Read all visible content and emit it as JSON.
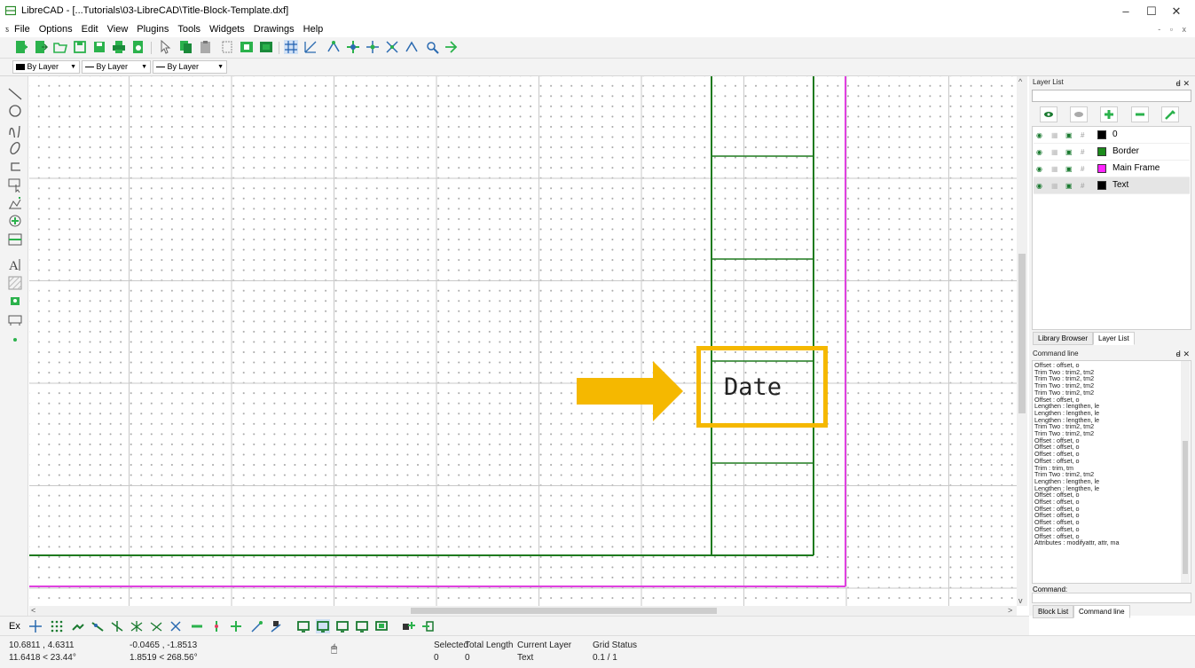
{
  "window": {
    "title": "LibreCAD - [...Tutorials\\03-LibreCAD\\Title-Block-Template.dxf]",
    "controls": [
      "–",
      "☐",
      "✕"
    ]
  },
  "menubar": {
    "items": [
      "File",
      "Options",
      "Edit",
      "View",
      "Plugins",
      "Tools",
      "Widgets",
      "Drawings",
      "Help"
    ],
    "mdi_controls": "- ▫ x"
  },
  "pen_toolbar": {
    "color": "By Layer",
    "width": "By Layer",
    "linetype": "By Layer"
  },
  "drawing": {
    "text_label": "Date",
    "colors": {
      "border": "#1e7a1e",
      "main_frame": "#e040e0",
      "grid": "#c9c9c9",
      "highlight": "#f5b800"
    }
  },
  "layer_panel": {
    "title": "Layer List",
    "layers": [
      {
        "name": "0",
        "color": "#000000",
        "selected": false
      },
      {
        "name": "Border",
        "color": "#1b8a1b",
        "selected": false
      },
      {
        "name": "Main Frame",
        "color": "#ff22ff",
        "selected": false
      },
      {
        "name": "Text",
        "color": "#000000",
        "selected": true
      }
    ],
    "tabs": [
      "Library Browser",
      "Layer List"
    ]
  },
  "command_panel": {
    "title": "Command line",
    "history": [
      "Offset : offset, o",
      "Trim Two : trim2, tm2",
      "Trim Two : trim2, tm2",
      "Trim Two : trim2, tm2",
      "Trim Two : trim2, tm2",
      "Offset : offset, o",
      "Lengthen : lengthen, le",
      "Lengthen : lengthen, le",
      "Lengthen : lengthen, le",
      "Trim Two : trim2, tm2",
      "Trim Two : trim2, tm2",
      "Offset : offset, o",
      "Offset : offset, o",
      "Offset : offset, o",
      "Offset : offset, o",
      "Trim : trim, tm",
      "Trim Two : trim2, tm2",
      "Lengthen : lengthen, le",
      "Lengthen : lengthen, le",
      "Offset : offset, o",
      "Offset : offset, o",
      "Offset : offset, o",
      "Offset : offset, o",
      "Offset : offset, o",
      "Offset : offset, o",
      "Offset : offset, o",
      "Attributes : modifyattr, attr, ma"
    ],
    "command_label": "Command:",
    "tabs": [
      "Block List",
      "Command line"
    ]
  },
  "snap_toolbar": {
    "label": "Ex"
  },
  "status": {
    "abs_coord": "10.6811 , 4.6311",
    "abs_polar": "11.6418 < 23.44°",
    "rel_coord": "-0.0465 , -1.8513",
    "rel_polar": "1.8519 < 268.56°",
    "selected_label": "Selected",
    "selected_value": "0",
    "total_length_label": "Total Length",
    "total_length_value": "0",
    "current_layer_label": "Current Layer",
    "current_layer_value": "Text",
    "grid_status_label": "Grid Status",
    "grid_status_value": "0.1 / 1"
  }
}
